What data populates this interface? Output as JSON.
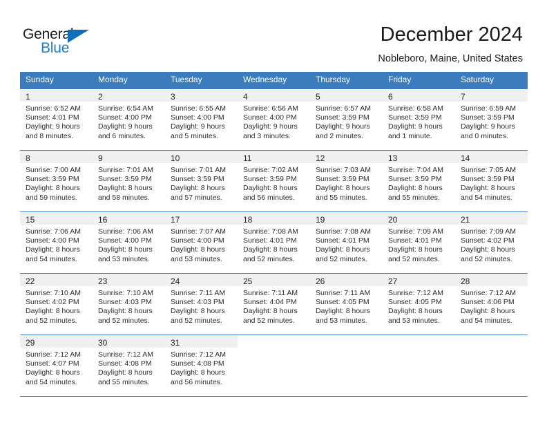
{
  "brand": {
    "name_top": "General",
    "name_bottom": "Blue",
    "triangle_icon": "triangle-icon",
    "color_dark": "#1b1b1b",
    "color_blue": "#1f7ac4"
  },
  "header": {
    "title": "December 2024",
    "subtitle": "Nobleboro, Maine, United States"
  },
  "theme": {
    "header_row_bg": "#3a7cbe",
    "header_row_text": "#ffffff",
    "daynum_band_bg": "#f0f0f0",
    "cell_bg": "#ffffff",
    "grid_line": "#3a7cbe",
    "body_text": "#2b2b2b"
  },
  "calendar": {
    "weekdays": [
      "Sunday",
      "Monday",
      "Tuesday",
      "Wednesday",
      "Thursday",
      "Friday",
      "Saturday"
    ],
    "weeks": [
      [
        {
          "day": "1",
          "sunrise": "Sunrise: 6:52 AM",
          "sunset": "Sunset: 4:01 PM",
          "daylight_1": "Daylight: 9 hours",
          "daylight_2": "and 8 minutes."
        },
        {
          "day": "2",
          "sunrise": "Sunrise: 6:54 AM",
          "sunset": "Sunset: 4:00 PM",
          "daylight_1": "Daylight: 9 hours",
          "daylight_2": "and 6 minutes."
        },
        {
          "day": "3",
          "sunrise": "Sunrise: 6:55 AM",
          "sunset": "Sunset: 4:00 PM",
          "daylight_1": "Daylight: 9 hours",
          "daylight_2": "and 5 minutes."
        },
        {
          "day": "4",
          "sunrise": "Sunrise: 6:56 AM",
          "sunset": "Sunset: 4:00 PM",
          "daylight_1": "Daylight: 9 hours",
          "daylight_2": "and 3 minutes."
        },
        {
          "day": "5",
          "sunrise": "Sunrise: 6:57 AM",
          "sunset": "Sunset: 3:59 PM",
          "daylight_1": "Daylight: 9 hours",
          "daylight_2": "and 2 minutes."
        },
        {
          "day": "6",
          "sunrise": "Sunrise: 6:58 AM",
          "sunset": "Sunset: 3:59 PM",
          "daylight_1": "Daylight: 9 hours",
          "daylight_2": "and 1 minute."
        },
        {
          "day": "7",
          "sunrise": "Sunrise: 6:59 AM",
          "sunset": "Sunset: 3:59 PM",
          "daylight_1": "Daylight: 9 hours",
          "daylight_2": "and 0 minutes."
        }
      ],
      [
        {
          "day": "8",
          "sunrise": "Sunrise: 7:00 AM",
          "sunset": "Sunset: 3:59 PM",
          "daylight_1": "Daylight: 8 hours",
          "daylight_2": "and 59 minutes."
        },
        {
          "day": "9",
          "sunrise": "Sunrise: 7:01 AM",
          "sunset": "Sunset: 3:59 PM",
          "daylight_1": "Daylight: 8 hours",
          "daylight_2": "and 58 minutes."
        },
        {
          "day": "10",
          "sunrise": "Sunrise: 7:01 AM",
          "sunset": "Sunset: 3:59 PM",
          "daylight_1": "Daylight: 8 hours",
          "daylight_2": "and 57 minutes."
        },
        {
          "day": "11",
          "sunrise": "Sunrise: 7:02 AM",
          "sunset": "Sunset: 3:59 PM",
          "daylight_1": "Daylight: 8 hours",
          "daylight_2": "and 56 minutes."
        },
        {
          "day": "12",
          "sunrise": "Sunrise: 7:03 AM",
          "sunset": "Sunset: 3:59 PM",
          "daylight_1": "Daylight: 8 hours",
          "daylight_2": "and 55 minutes."
        },
        {
          "day": "13",
          "sunrise": "Sunrise: 7:04 AM",
          "sunset": "Sunset: 3:59 PM",
          "daylight_1": "Daylight: 8 hours",
          "daylight_2": "and 55 minutes."
        },
        {
          "day": "14",
          "sunrise": "Sunrise: 7:05 AM",
          "sunset": "Sunset: 3:59 PM",
          "daylight_1": "Daylight: 8 hours",
          "daylight_2": "and 54 minutes."
        }
      ],
      [
        {
          "day": "15",
          "sunrise": "Sunrise: 7:06 AM",
          "sunset": "Sunset: 4:00 PM",
          "daylight_1": "Daylight: 8 hours",
          "daylight_2": "and 54 minutes."
        },
        {
          "day": "16",
          "sunrise": "Sunrise: 7:06 AM",
          "sunset": "Sunset: 4:00 PM",
          "daylight_1": "Daylight: 8 hours",
          "daylight_2": "and 53 minutes."
        },
        {
          "day": "17",
          "sunrise": "Sunrise: 7:07 AM",
          "sunset": "Sunset: 4:00 PM",
          "daylight_1": "Daylight: 8 hours",
          "daylight_2": "and 53 minutes."
        },
        {
          "day": "18",
          "sunrise": "Sunrise: 7:08 AM",
          "sunset": "Sunset: 4:01 PM",
          "daylight_1": "Daylight: 8 hours",
          "daylight_2": "and 52 minutes."
        },
        {
          "day": "19",
          "sunrise": "Sunrise: 7:08 AM",
          "sunset": "Sunset: 4:01 PM",
          "daylight_1": "Daylight: 8 hours",
          "daylight_2": "and 52 minutes."
        },
        {
          "day": "20",
          "sunrise": "Sunrise: 7:09 AM",
          "sunset": "Sunset: 4:01 PM",
          "daylight_1": "Daylight: 8 hours",
          "daylight_2": "and 52 minutes."
        },
        {
          "day": "21",
          "sunrise": "Sunrise: 7:09 AM",
          "sunset": "Sunset: 4:02 PM",
          "daylight_1": "Daylight: 8 hours",
          "daylight_2": "and 52 minutes."
        }
      ],
      [
        {
          "day": "22",
          "sunrise": "Sunrise: 7:10 AM",
          "sunset": "Sunset: 4:02 PM",
          "daylight_1": "Daylight: 8 hours",
          "daylight_2": "and 52 minutes."
        },
        {
          "day": "23",
          "sunrise": "Sunrise: 7:10 AM",
          "sunset": "Sunset: 4:03 PM",
          "daylight_1": "Daylight: 8 hours",
          "daylight_2": "and 52 minutes."
        },
        {
          "day": "24",
          "sunrise": "Sunrise: 7:11 AM",
          "sunset": "Sunset: 4:03 PM",
          "daylight_1": "Daylight: 8 hours",
          "daylight_2": "and 52 minutes."
        },
        {
          "day": "25",
          "sunrise": "Sunrise: 7:11 AM",
          "sunset": "Sunset: 4:04 PM",
          "daylight_1": "Daylight: 8 hours",
          "daylight_2": "and 52 minutes."
        },
        {
          "day": "26",
          "sunrise": "Sunrise: 7:11 AM",
          "sunset": "Sunset: 4:05 PM",
          "daylight_1": "Daylight: 8 hours",
          "daylight_2": "and 53 minutes."
        },
        {
          "day": "27",
          "sunrise": "Sunrise: 7:12 AM",
          "sunset": "Sunset: 4:05 PM",
          "daylight_1": "Daylight: 8 hours",
          "daylight_2": "and 53 minutes."
        },
        {
          "day": "28",
          "sunrise": "Sunrise: 7:12 AM",
          "sunset": "Sunset: 4:06 PM",
          "daylight_1": "Daylight: 8 hours",
          "daylight_2": "and 54 minutes."
        }
      ],
      [
        {
          "day": "29",
          "sunrise": "Sunrise: 7:12 AM",
          "sunset": "Sunset: 4:07 PM",
          "daylight_1": "Daylight: 8 hours",
          "daylight_2": "and 54 minutes."
        },
        {
          "day": "30",
          "sunrise": "Sunrise: 7:12 AM",
          "sunset": "Sunset: 4:08 PM",
          "daylight_1": "Daylight: 8 hours",
          "daylight_2": "and 55 minutes."
        },
        {
          "day": "31",
          "sunrise": "Sunrise: 7:12 AM",
          "sunset": "Sunset: 4:08 PM",
          "daylight_1": "Daylight: 8 hours",
          "daylight_2": "and 56 minutes."
        },
        {
          "day": "",
          "sunrise": "",
          "sunset": "",
          "daylight_1": "",
          "daylight_2": ""
        },
        {
          "day": "",
          "sunrise": "",
          "sunset": "",
          "daylight_1": "",
          "daylight_2": ""
        },
        {
          "day": "",
          "sunrise": "",
          "sunset": "",
          "daylight_1": "",
          "daylight_2": ""
        },
        {
          "day": "",
          "sunrise": "",
          "sunset": "",
          "daylight_1": "",
          "daylight_2": ""
        }
      ]
    ]
  }
}
